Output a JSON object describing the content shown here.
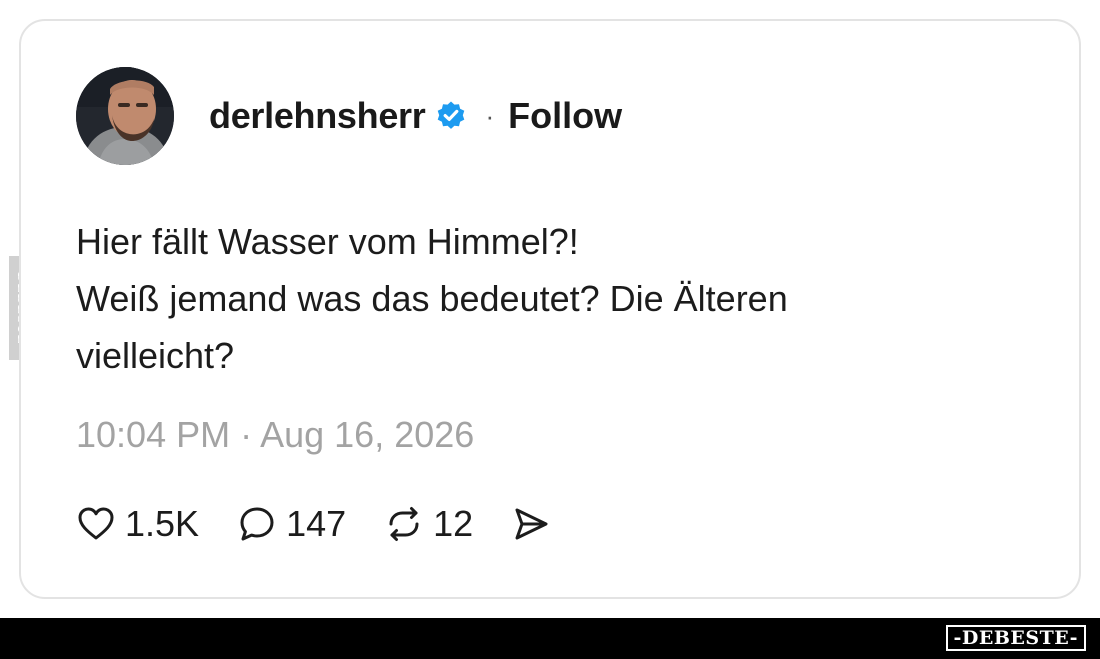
{
  "post": {
    "username": "derlehnsherr",
    "separator": "·",
    "follow_label": "Follow",
    "text_lines": [
      "Hier fällt Wasser vom Himmel?!",
      "Weiß jemand was das bedeutet? Die Älteren",
      "vielleicht?"
    ],
    "timestamp": "10:04 PM · Aug 16, 2026"
  },
  "actions": {
    "likes": "1.5K",
    "replies": "147",
    "reposts": "12"
  },
  "icons": {
    "verified": "verified-badge-icon",
    "like": "heart-icon",
    "reply": "speech-bubble-icon",
    "repost": "repost-icon",
    "share": "send-icon"
  },
  "colors": {
    "verified_blue": "#1d9bf0",
    "meta_gray": "#a3a3a3",
    "card_border": "#e3e3e3"
  },
  "watermark": {
    "side": "DEBESTE",
    "logo": "-DEBESTE-"
  }
}
